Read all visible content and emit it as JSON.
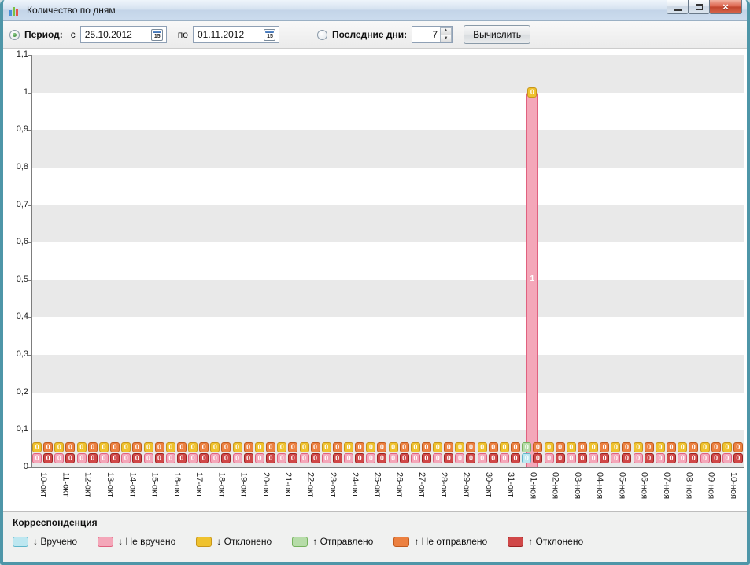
{
  "window": {
    "title": "Количество по дням",
    "close_glyph": "×"
  },
  "toolbar": {
    "period": {
      "label": "Период:",
      "selected": true
    },
    "from_label": "с",
    "from_date": "25.10.2012",
    "to_label": "по",
    "to_date": "01.11.2012",
    "calendar_icon_day": "15",
    "last_days": {
      "label": "Последние дни:",
      "selected": false,
      "value": "7"
    },
    "calculate_button": "Вычислить"
  },
  "chart_data": {
    "type": "bar",
    "stacked": true,
    "title": "",
    "legend_title": "Корреспонденция",
    "legend_position": "bottom",
    "grid": "horizontal-bands",
    "ylim": [
      0,
      1.1
    ],
    "yticks": [
      "0",
      "0,1",
      "0,2",
      "0,3",
      "0,4",
      "0,5",
      "0,6",
      "0,7",
      "0,8",
      "0,9",
      "1",
      "1,1"
    ],
    "x_rotation": 90,
    "categories": [
      "10-окт",
      "11-окт",
      "12-окт",
      "13-окт",
      "14-окт",
      "15-окт",
      "16-окт",
      "17-окт",
      "18-окт",
      "19-окт",
      "20-окт",
      "21-окт",
      "22-окт",
      "23-окт",
      "24-окт",
      "25-окт",
      "26-окт",
      "27-окт",
      "28-окт",
      "29-окт",
      "30-окт",
      "31-окт",
      "01-ноя",
      "02-ноя",
      "03-ноя",
      "04-ноя",
      "05-ноя",
      "06-ноя",
      "07-ноя",
      "08-ноя",
      "09-ноя",
      "10-ноя"
    ],
    "series": [
      {
        "name": "↓ Вручено",
        "key": "delivered",
        "bg": "#bde7f0",
        "border": "#5fb6cb",
        "values": [
          0,
          0,
          0,
          0,
          0,
          0,
          0,
          0,
          0,
          0,
          0,
          0,
          0,
          0,
          0,
          0,
          0,
          0,
          0,
          0,
          0,
          0,
          0,
          0,
          0,
          0,
          0,
          0,
          0,
          0,
          0,
          0
        ]
      },
      {
        "name": "↓ Не вручено",
        "key": "not-delivered",
        "bg": "#f4a7b9",
        "border": "#e0617f",
        "values": [
          0,
          0,
          0,
          0,
          0,
          0,
          0,
          0,
          0,
          0,
          0,
          0,
          0,
          0,
          0,
          0,
          0,
          0,
          0,
          0,
          0,
          0,
          1,
          0,
          0,
          0,
          0,
          0,
          0,
          0,
          0,
          0
        ]
      },
      {
        "name": "↓ Отклонено",
        "key": "rejected-in",
        "bg": "#efc22e",
        "border": "#c8961a",
        "values": [
          0,
          0,
          0,
          0,
          0,
          0,
          0,
          0,
          0,
          0,
          0,
          0,
          0,
          0,
          0,
          0,
          0,
          0,
          0,
          0,
          0,
          0,
          0,
          0,
          0,
          0,
          0,
          0,
          0,
          0,
          0,
          0
        ]
      },
      {
        "name": "↑ Отправлено",
        "key": "sent",
        "bg": "#b6dca8",
        "border": "#76b25e",
        "values": [
          0,
          0,
          0,
          0,
          0,
          0,
          0,
          0,
          0,
          0,
          0,
          0,
          0,
          0,
          0,
          0,
          0,
          0,
          0,
          0,
          0,
          0,
          0,
          0,
          0,
          0,
          0,
          0,
          0,
          0,
          0,
          0
        ]
      },
      {
        "name": "↑ Не отправлено",
        "key": "not-sent",
        "bg": "#ec8040",
        "border": "#c05a1e",
        "values": [
          0,
          0,
          0,
          0,
          0,
          0,
          0,
          0,
          0,
          0,
          0,
          0,
          0,
          0,
          0,
          0,
          0,
          0,
          0,
          0,
          0,
          0,
          0,
          0,
          0,
          0,
          0,
          0,
          0,
          0,
          0,
          0
        ]
      },
      {
        "name": "↑ Отклонено",
        "key": "rejected-out",
        "bg": "#d04848",
        "border": "#9c2222",
        "values": [
          0,
          0,
          0,
          0,
          0,
          0,
          0,
          0,
          0,
          0,
          0,
          0,
          0,
          0,
          0,
          0,
          0,
          0,
          0,
          0,
          0,
          0,
          0,
          0,
          0,
          0,
          0,
          0,
          0,
          0,
          0,
          0
        ]
      }
    ]
  }
}
